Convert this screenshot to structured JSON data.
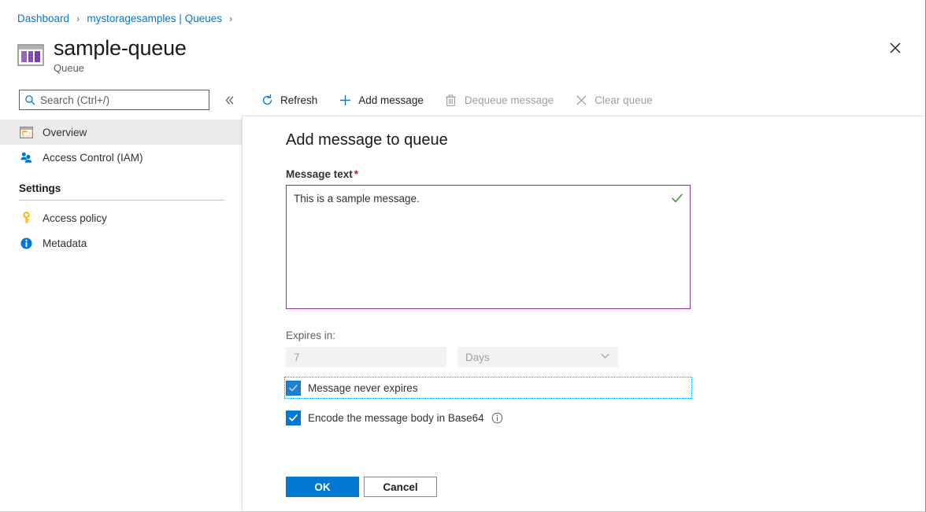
{
  "breadcrumb": {
    "items": [
      {
        "label": "Dashboard"
      },
      {
        "label": "mystoragesamples | Queues"
      }
    ],
    "separator": "›"
  },
  "header": {
    "title": "sample-queue",
    "subtitle": "Queue",
    "icon": "queue-icon",
    "close_label": "✕"
  },
  "search": {
    "placeholder": "Search (Ctrl+/)",
    "value": "",
    "icon": "search-icon",
    "collapse_icon": "chevron-double-left-icon"
  },
  "sidebar": {
    "items": [
      {
        "label": "Overview",
        "icon": "overview-icon",
        "selected": true
      },
      {
        "label": "Access Control (IAM)",
        "icon": "people-icon",
        "selected": false
      }
    ],
    "section_title": "Settings",
    "settings_items": [
      {
        "label": "Access policy",
        "icon": "key-icon"
      },
      {
        "label": "Metadata",
        "icon": "info-icon"
      }
    ]
  },
  "toolbar": {
    "buttons": [
      {
        "label": "Refresh",
        "icon": "refresh-icon",
        "disabled": false
      },
      {
        "label": "Add message",
        "icon": "plus-icon",
        "disabled": false
      },
      {
        "label": "Dequeue message",
        "icon": "trash-icon",
        "disabled": true
      },
      {
        "label": "Clear queue",
        "icon": "close-x-icon",
        "disabled": true
      }
    ]
  },
  "panel": {
    "title": "Add message to queue",
    "message_field": {
      "label": "Message text",
      "required_marker": "*",
      "value": "This is a sample message.",
      "valid_icon": "checkmark-icon"
    },
    "expires": {
      "label": "Expires in:",
      "amount_value": "7",
      "unit_value": "Days",
      "unit_chevron": "chevron-down-icon",
      "disabled": true
    },
    "checkboxes": [
      {
        "label": "Message never expires",
        "checked": true,
        "focused": true,
        "info": false
      },
      {
        "label": "Encode the message body in Base64",
        "checked": true,
        "focused": false,
        "info": true,
        "info_icon": "info-circle-icon"
      }
    ],
    "buttons": {
      "ok": "OK",
      "cancel": "Cancel"
    }
  },
  "colors": {
    "accent": "#0078d4",
    "focus_border": "#8f2fa0",
    "valid_check": "#107c10",
    "required": "#a4262c",
    "selected_row": "#edebe9"
  }
}
